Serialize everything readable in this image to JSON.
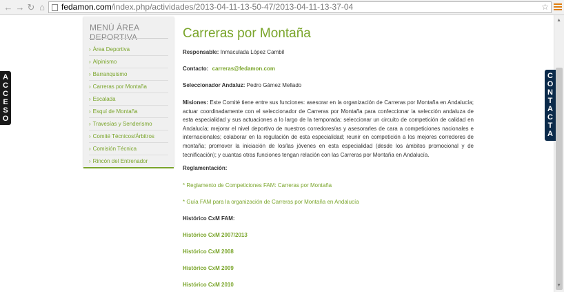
{
  "browser": {
    "url_host": "fedamon.com",
    "url_path": "/index.php/actividades/2013-04-11-13-50-47/2013-04-11-13-37-04"
  },
  "sidebar": {
    "title": "MENÚ ÁREA DEPORTIVA",
    "items": [
      {
        "label": "Área Deportiva"
      },
      {
        "label": "Alpinismo"
      },
      {
        "label": "Barranquismo"
      },
      {
        "label": "Carreras por Montaña"
      },
      {
        "label": "Escalada"
      },
      {
        "label": "Esquí de Montaña"
      },
      {
        "label": "Travesías y Senderismo"
      },
      {
        "label": "Comité Técnicos/Árbitros"
      },
      {
        "label": "Comisión Técnica"
      },
      {
        "label": "Rincón del Entrenador"
      }
    ]
  },
  "side_tabs": {
    "left": "ACCESO",
    "right": "CONTACTA"
  },
  "content": {
    "title": "Carreras por Montaña",
    "responsable_label": "Responsable:",
    "responsable_value": "Inmaculada López Cambil",
    "contacto_label": "Contacto:",
    "contacto_value": "carreras@fedamon.com",
    "seleccionador_label": "Seleccionador Andaluz:",
    "seleccionador_value": "Pedro Gámez Mellado",
    "misiones_label": "Misiones:",
    "misiones_text": "Este Comité tiene entre sus funciones: asesorar en la organización de Carreras por Montaña en Andalucía; actuar coordinadamente con el seleccionador de Carreras por Montaña para confeccionar la selección andaluza de esta especialidad y sus actuaciones a lo largo de la temporada; seleccionar un circuito de competición de calidad en Andalucía; mejorar el nivel deportivo de nuestros corredores/as y asesorarles de cara a competiciones nacionales e internacionales; colaborar en la regulación de esta especialidad; reunir en competición a los mejores corredores de montaña; promover la iniciación de los/las jóvenes en esta especialidad (desde los ámbitos promocional y de tecnificación); y cuantas otras funciones tengan relación con las Carreras por Montaña en Andalucía.",
    "reglamentacion_label": "Reglamentación:",
    "reglamentos": [
      "* Reglamento de Competiciones FAM: Carreras por Montaña",
      "* Guía FAM para la organización de Carreras por Montaña en Andalucía"
    ],
    "historico_label": "Histórico CxM FAM:",
    "historicos": [
      "Histórico CxM 2007/2013",
      "Histórico CxM 2008",
      "Histórico CxM 2009",
      "Histórico CxM 2010"
    ]
  },
  "colors": {
    "accent_green": "#7aa52b",
    "right_tab": "#0b2a4a",
    "left_tab": "#1a1a1a"
  }
}
